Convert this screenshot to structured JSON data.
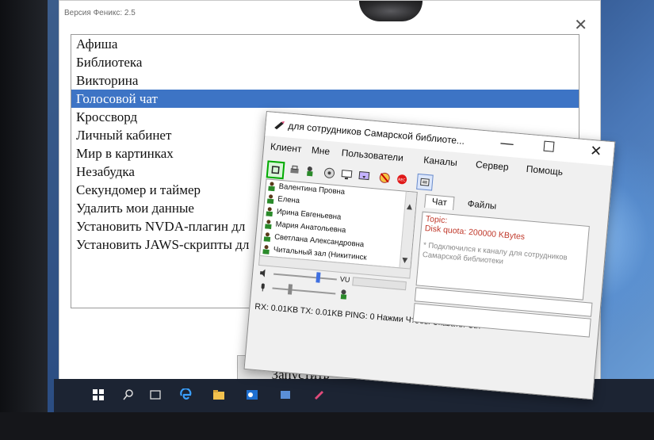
{
  "phoenix": {
    "title": "Версия Феникс: 2.5",
    "close_glyph": "✕",
    "menu_items": [
      "Афиша",
      "Библиотека",
      "Викторина",
      "Голосовой чат",
      "Кроссворд",
      "Личный кабинет",
      "Мир в картинках",
      "Незабудка",
      "Секундомер и таймер",
      "Удалить мои данные",
      "Установить NVDA-плагин дл",
      "Установить JAWS-скрипты дл"
    ],
    "selected_index": 3,
    "launch_label": "Запустить"
  },
  "teamtalk": {
    "title": "для сотрудников Самарской библиоте...",
    "window_buttons": {
      "minimize": "—",
      "maximize": "☐",
      "close": "✕"
    },
    "menu": [
      "Клиент",
      "Мне",
      "Пользователи",
      "Каналы",
      "Сервер",
      "Помощь"
    ],
    "users": [
      "Валентина Провна",
      "Елена",
      "Ирина Евгеньевна",
      "Мария Анатольевна",
      "Светлана Александровна",
      "Читальный зал (Никитинск"
    ],
    "vu_label": "VU",
    "tabs": [
      "Чат",
      "Файлы"
    ],
    "chat": {
      "topic": "Topic:",
      "quota": "Disk quota: 200000 KBytes",
      "message": "* Подключился к каналу для сотрудников Самарской библиотеки"
    },
    "status": "RX: 0.01KB TX: 0.01KB PING: 0 Нажми Чтобы Сказать: Ctrl"
  },
  "colors": {
    "selection": "#3d74c5",
    "chat_red": "#c0392b",
    "slider_blue": "#3f6fe0",
    "desktop_blue": "#2a4c82"
  },
  "icons": {
    "toolbar": [
      "connect-icon",
      "printer-icon",
      "user-speak-icon",
      "record-cd-icon",
      "monitor-icon",
      "desktop-share-icon",
      "mute-icon",
      "rec-icon",
      "video-icon"
    ],
    "taskbar": [
      "start-icon",
      "search-icon",
      "task-view-icon",
      "edge-icon",
      "explorer-icon",
      "outlook-icon",
      "app-icon",
      "teamtalk-icon"
    ]
  }
}
